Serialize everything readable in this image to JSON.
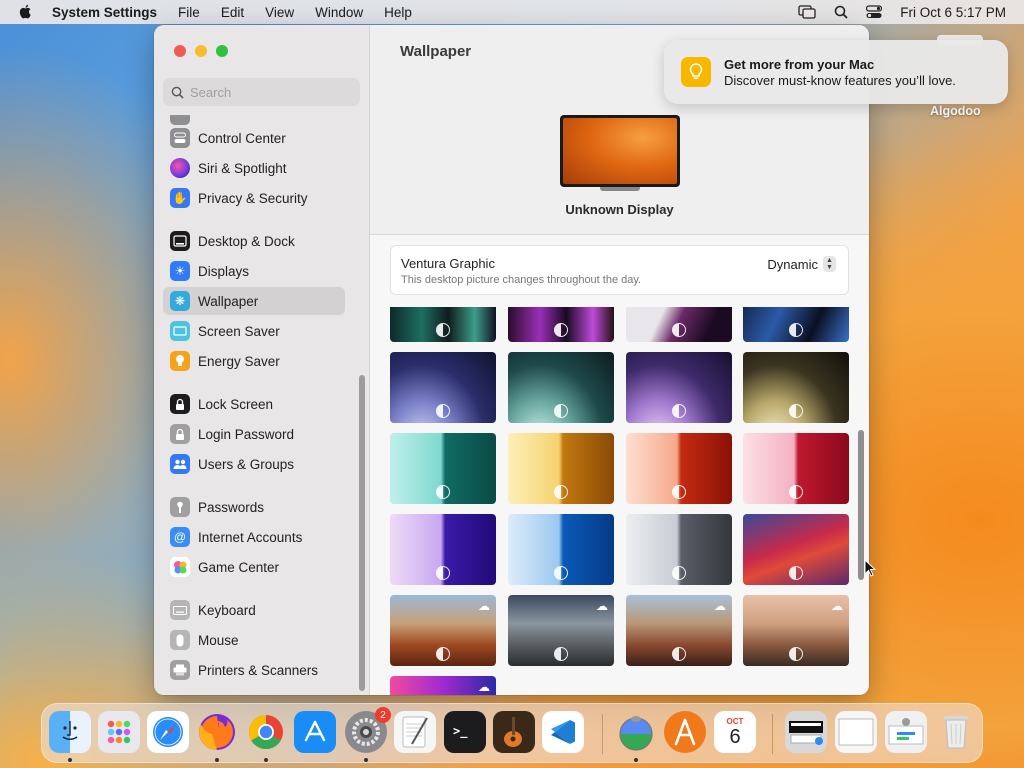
{
  "menubar": {
    "app_name": "System Settings",
    "menus": [
      "File",
      "Edit",
      "View",
      "Window",
      "Help"
    ],
    "clock": "Fri Oct 6  5:17 PM"
  },
  "notification": {
    "title": "Get more from your Mac",
    "body": "Discover must-know features you’ll love."
  },
  "desktop": {
    "file_label": "Algodoo"
  },
  "sidebar": {
    "search_placeholder": "Search",
    "items": [
      {
        "label": "Control Center",
        "icon": "control-center-icon",
        "color": "#8e8e93"
      },
      {
        "label": "Siri & Spotlight",
        "icon": "siri-icon",
        "color": "#c03aa0"
      },
      {
        "label": "Privacy & Security",
        "icon": "hand-icon",
        "color": "#3478f6"
      },
      {
        "label": "Desktop & Dock",
        "icon": "dock-icon",
        "color": "#1c1c1e"
      },
      {
        "label": "Displays",
        "icon": "sun-icon",
        "color": "#2f7cf6"
      },
      {
        "label": "Wallpaper",
        "icon": "wallpaper-icon",
        "color": "#34aadc",
        "selected": true
      },
      {
        "label": "Screen Saver",
        "icon": "screen-saver-icon",
        "color": "#4cc3e0"
      },
      {
        "label": "Energy Saver",
        "icon": "bulb-icon",
        "color": "#f7a21b"
      },
      {
        "label": "Lock Screen",
        "icon": "lock-icon",
        "color": "#1c1c1e"
      },
      {
        "label": "Login Password",
        "icon": "lock-icon",
        "color": "#a0a0a0"
      },
      {
        "label": "Users & Groups",
        "icon": "users-icon",
        "color": "#3478f6"
      },
      {
        "label": "Passwords",
        "icon": "key-icon",
        "color": "#a0a0a0"
      },
      {
        "label": "Internet Accounts",
        "icon": "at-icon",
        "color": "#3b8df6"
      },
      {
        "label": "Game Center",
        "icon": "game-center-icon",
        "color": "#ffffff"
      },
      {
        "label": "Keyboard",
        "icon": "keyboard-icon",
        "color": "#b5b5b5"
      },
      {
        "label": "Mouse",
        "icon": "mouse-icon",
        "color": "#b5b5b5"
      },
      {
        "label": "Printers & Scanners",
        "icon": "printer-icon",
        "color": "#a0a0a0"
      }
    ]
  },
  "main": {
    "title": "Wallpaper",
    "display_name": "Unknown Display",
    "wallpaper_name": "Ventura Graphic",
    "wallpaper_desc": "This desktop picture changes throughout the day.",
    "mode": "Dynamic"
  },
  "dock": {
    "settings_badge": "2",
    "calendar_month": "OCT",
    "calendar_day": "6"
  }
}
